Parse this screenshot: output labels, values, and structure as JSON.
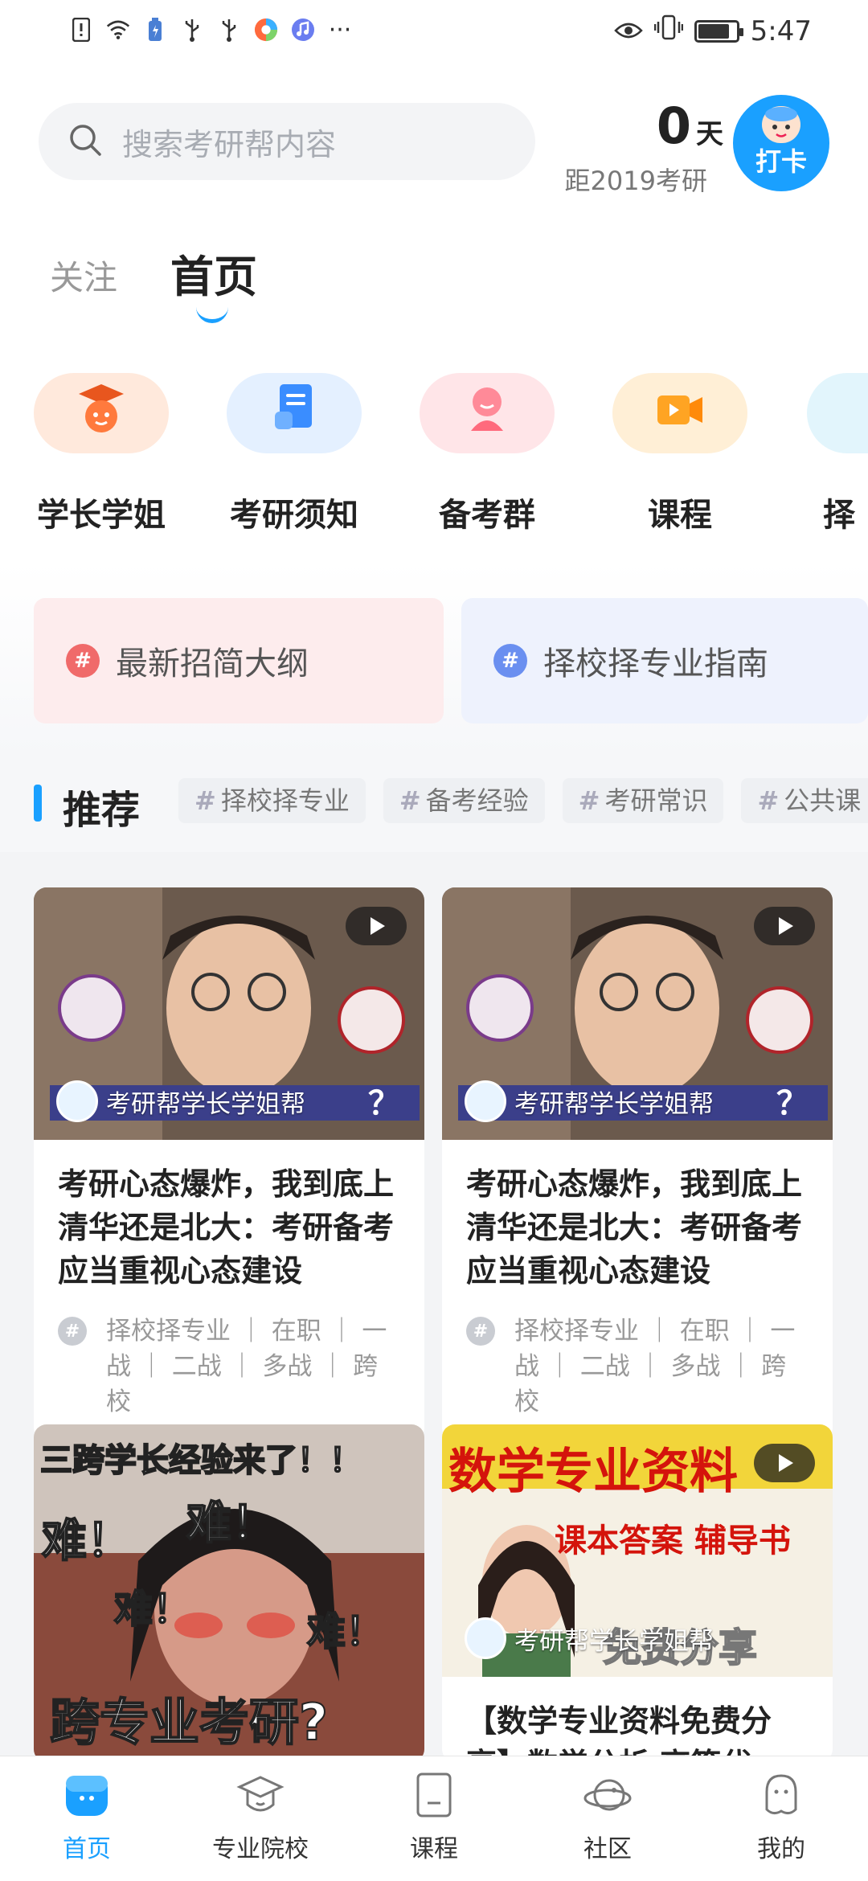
{
  "status_bar": {
    "time": "5:47",
    "left_icons": [
      "alert-icon",
      "wifi-icon",
      "battery-saver-icon",
      "usb-icon",
      "usb-icon",
      "browser-app-icon",
      "music-app-icon"
    ],
    "more": "···",
    "battery_level": 0.85
  },
  "header": {
    "search_placeholder": "搜索考研帮内容",
    "countdown_value": "0",
    "countdown_unit": "天",
    "countdown_caption": "距2019考研",
    "checkin_label": "打卡"
  },
  "top_tabs": {
    "follow": "关注",
    "home": "首页"
  },
  "categories": [
    {
      "label": "学长学姐",
      "icon": "graduate-icon",
      "color": "#ff7a3d",
      "bg": "#ffe9dc"
    },
    {
      "label": "考研须知",
      "icon": "document-icon",
      "color": "#3a8dff",
      "bg": "#e4f0ff"
    },
    {
      "label": "备考群",
      "icon": "group-icon",
      "color": "#ff6a7d",
      "bg": "#ffe5e8"
    },
    {
      "label": "课程",
      "icon": "video-camera-icon",
      "color": "#ffa423",
      "bg": "#ffefd6"
    },
    {
      "label": "择",
      "icon": "more-category-icon",
      "color": "#48b8f0",
      "bg": "#e2f5fc"
    }
  ],
  "banners": [
    {
      "label": "最新招简大纲",
      "hash_color": "#f06a6a",
      "bg": "#fdeced"
    },
    {
      "label": "择校择专业指南",
      "hash_color": "#6a8ff0",
      "bg": "#eef2fd"
    }
  ],
  "recommend": {
    "title": "推荐",
    "chips": [
      "择校择专业",
      "备考经验",
      "考研常识",
      "公共课"
    ]
  },
  "cards": [
    {
      "author": "考研帮学长学姐帮",
      "title": "考研心态爆炸，我到底上清华还是北大：考研备考应当重视心态建设",
      "tags": "择校择专业 ｜ 在职 ｜ 一战 ｜ 二战 ｜ 多战 ｜ 跨校",
      "thumb_caption": "？"
    },
    {
      "author": "考研帮学长学姐帮",
      "title": "考研心态爆炸，我到底上清华还是北大：考研备考应当重视心态建设",
      "tags": "择校择专业 ｜ 在职 ｜ 一战 ｜ 二战 ｜ 多战 ｜ 跨校",
      "thumb_caption": "？"
    },
    {
      "thumb_top": "三跨学长经验来了！！",
      "thumb_words": [
        "难！",
        "难！",
        "难！",
        "难！"
      ],
      "thumb_bottom": "跨专业考研?"
    },
    {
      "author": "考研帮学长学姐帮",
      "thumb_headline": "数学专业资料",
      "thumb_sub": "课本答案 辅导书",
      "thumb_bottom": "免费分享",
      "title": "【数学专业资料免费分享】数学分析 高等代"
    }
  ],
  "bottom_nav": [
    {
      "label": "首页",
      "icon": "home-icon",
      "active": true
    },
    {
      "label": "专业院校",
      "icon": "graduation-cap-icon",
      "active": false
    },
    {
      "label": "课程",
      "icon": "course-book-icon",
      "active": false
    },
    {
      "label": "社区",
      "icon": "planet-icon",
      "active": false
    },
    {
      "label": "我的",
      "icon": "profile-icon",
      "active": false
    }
  ],
  "colors": {
    "accent": "#1aa0ff",
    "text": "#222222",
    "muted": "#999999"
  }
}
